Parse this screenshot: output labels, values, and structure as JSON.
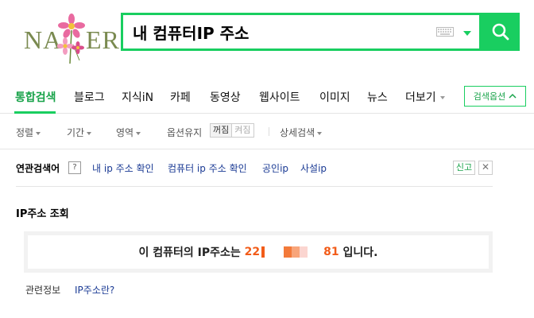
{
  "logo": {
    "text_left": "NA",
    "text_right": "ER"
  },
  "search": {
    "query": "내 컴퓨터IP 주소"
  },
  "tabs": [
    {
      "label": "통합검색",
      "active": true
    },
    {
      "label": "블로그"
    },
    {
      "label": "지식iN"
    },
    {
      "label": "카페"
    },
    {
      "label": "동영상"
    },
    {
      "label": "웹사이트"
    },
    {
      "label": "이미지"
    },
    {
      "label": "뉴스"
    },
    {
      "label": "더보기"
    }
  ],
  "search_options_label": "검색옵션",
  "filters": {
    "sort": "정렬",
    "period": "기간",
    "area": "영역",
    "keep_option": "옵션유지",
    "keep_off": "꺼짐",
    "keep_on": "켜짐",
    "detail": "상세검색"
  },
  "related": {
    "title": "연관검색어",
    "help": "?",
    "items": [
      "내 ip 주소 확인",
      "컴퓨터 ip 주소 확인",
      "공인ip",
      "사설ip"
    ],
    "report": "신고",
    "close": "✕"
  },
  "ip_lookup": {
    "title": "IP주소 조회",
    "prefix": "이 컴퓨터의 IP주소는",
    "ip_start": "22",
    "ip_end": "81",
    "suffix": "입니다."
  },
  "related_info": {
    "label": "관련정보",
    "link": "IP주소란?"
  },
  "colors": {
    "brand": "#19ce60",
    "link": "#1a3a94",
    "ip": "#f25c19"
  }
}
